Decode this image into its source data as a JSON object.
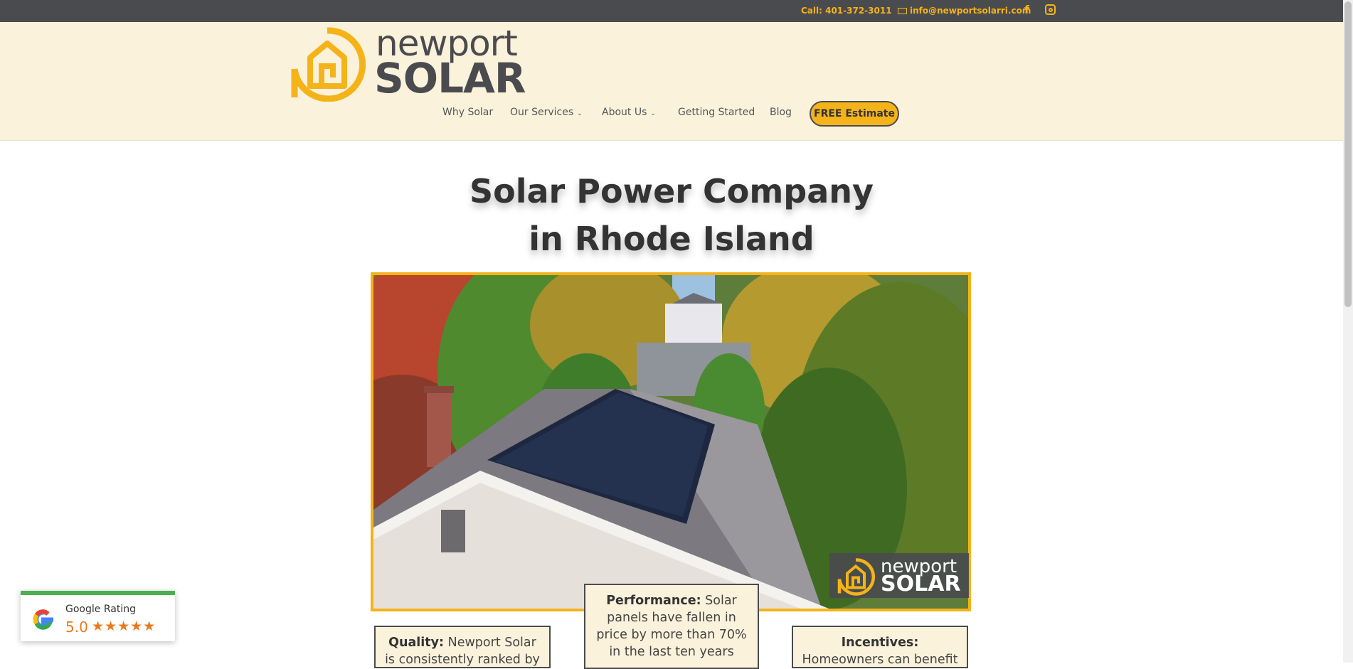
{
  "topbar": {
    "call": "Call: 401-372-3011",
    "email": "info@newportsolarri.com",
    "facebook_icon": "facebook-icon",
    "instagram_icon": "instagram-icon"
  },
  "brand": {
    "line1": "newport",
    "line2": "SOLAR",
    "accent": "#f5b31a",
    "dark": "#4a4b4e",
    "cream": "#fbf2dc"
  },
  "nav": {
    "items": [
      "Why Solar",
      "Our Services",
      "About Us",
      "Getting Started",
      "Blog"
    ],
    "cta": "FREE Estimate"
  },
  "hero": {
    "title_line1": "Solar Power Company",
    "title_line2": "in Rhode Island"
  },
  "photo_logo": {
    "line1": "newport",
    "line2": "SOLAR"
  },
  "cards": [
    {
      "label": "Quality:",
      "text": "Newport Solar is consistently ranked by the"
    },
    {
      "label": "Performance:",
      "text": "Solar panels have fallen in price by more than 70% in the last ten years"
    },
    {
      "label": "Incentives:",
      "text": "Homeowners can benefit from both"
    }
  ],
  "rating": {
    "label": "Google Rating",
    "score": "5.0",
    "stars": "★★★★★"
  }
}
